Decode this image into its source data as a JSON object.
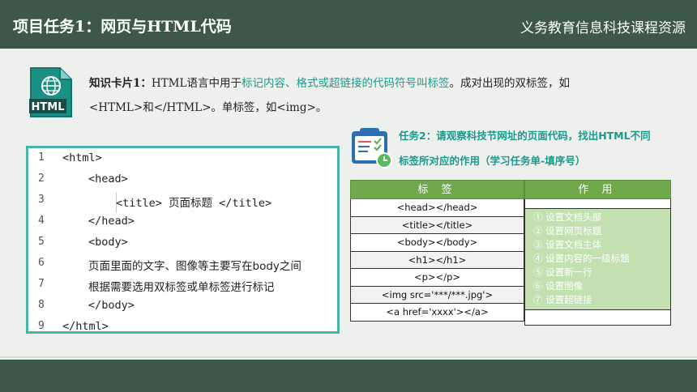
{
  "header": {
    "title": "项目任务1：网页与HTML代码",
    "subtitle": "义务教育信息科技课程资源"
  },
  "icons": {
    "html_file": "html-file-icon",
    "html_label": "HTML",
    "task_list": "task-clipboard-icon"
  },
  "card": {
    "lead": "知识卡片1：",
    "text_before": "HTML语言中用于",
    "highlight": "标记内容、格式或超链接的代码符号叫标签",
    "text_after": "。成对出现的双标签，如",
    "line2": "<HTML>和</HTML>。单标签，如<img>。"
  },
  "code": {
    "lines": [
      {
        "num": "1",
        "text": "<html>"
      },
      {
        "num": "2",
        "text": "<head>"
      },
      {
        "num": "3",
        "text": "<title> 页面标题 </title>"
      },
      {
        "num": "4",
        "text": "</head>"
      },
      {
        "num": "5",
        "text": "<body>"
      },
      {
        "num": "6",
        "text": "页面里面的文字、图像等主要写在body之间"
      },
      {
        "num": "7",
        "text": "根据需要选用双标签或单标签进行标记"
      },
      {
        "num": "8",
        "text": "</body>"
      },
      {
        "num": "9",
        "text": "</html>"
      }
    ]
  },
  "task": {
    "line1": "任务2：请观察科技节网址的页面代码，找出HTML不同",
    "line2": "标签所对应的作用（学习任务单-填序号）"
  },
  "table": {
    "headers": [
      "标 签",
      "作 用"
    ],
    "tags": [
      "<head></head>",
      "<title></title>",
      "<body></body>",
      "<h1></h1>",
      "<p></p>",
      "<img src='***/***.jpg'>",
      "<a href='xxxx'></a>"
    ],
    "functions": [
      "① 设置文档头部",
      "② 设置网页标题",
      "③ 设置文档主体",
      "④ 设置内容的一级标题",
      "⑤ 设置新一行",
      "⑥ 设置图像",
      "⑦ 设置超链接"
    ]
  },
  "colors": {
    "header_bg": "#3d5849",
    "accent_teal": "#1a9a8a",
    "table_header": "#70a84c",
    "function_bg": "#c3e0b1",
    "code_border": "#46b4a6"
  }
}
